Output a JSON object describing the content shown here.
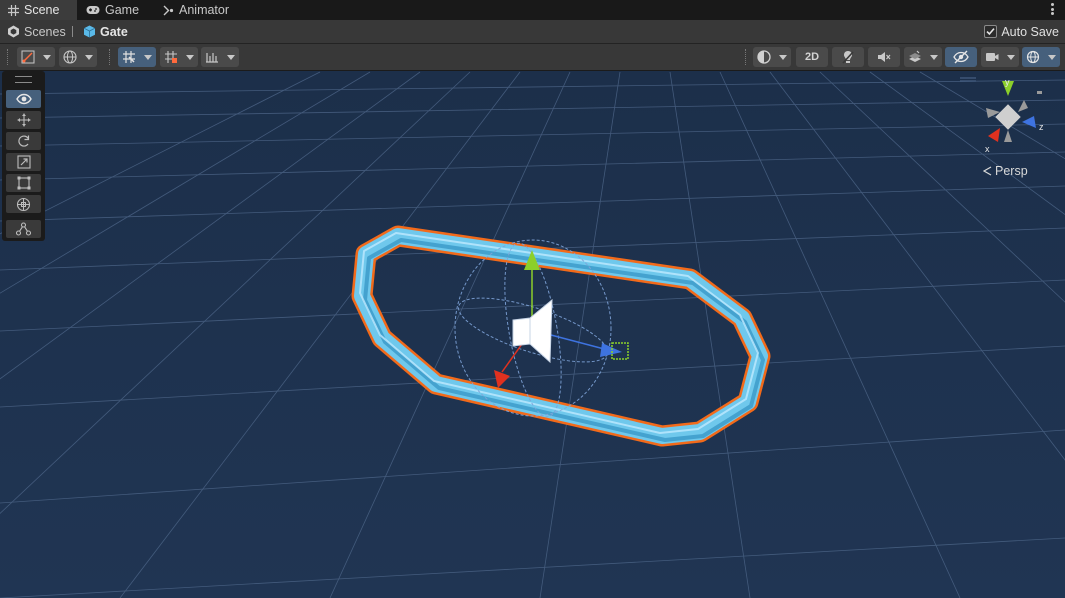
{
  "tabs": [
    {
      "label": "Scene",
      "icon": "grid-icon",
      "active": true
    },
    {
      "label": "Game",
      "icon": "gamepad-icon",
      "active": false
    },
    {
      "label": "Animator",
      "icon": "animator-icon",
      "active": false
    }
  ],
  "breadcrumb": {
    "root": "Scenes",
    "current": "Gate"
  },
  "autosave": {
    "label": "Auto Save",
    "checked": true
  },
  "toolbar": {
    "toggle_2d": "2D"
  },
  "gizmo": {
    "x": "x",
    "y": "y",
    "z": "z",
    "projection": "Persp"
  },
  "colors": {
    "viewport_bg": "#1f3350",
    "ring_fill": "#6fc8ec",
    "selection_outline": "#f26a1a",
    "axis_x": "#e0311f",
    "axis_y": "#8ccf2a",
    "axis_z": "#3e73e0",
    "active_button": "#46607c"
  }
}
